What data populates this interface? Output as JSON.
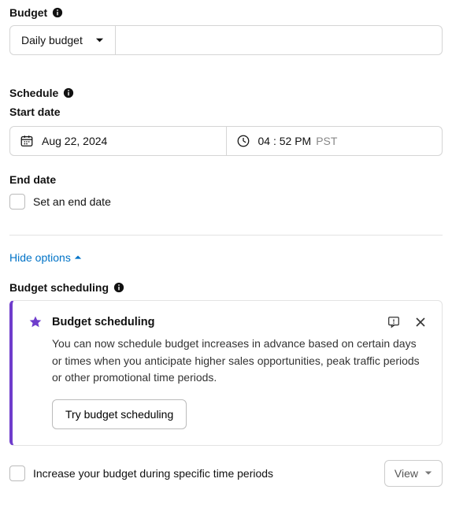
{
  "budget": {
    "label": "Budget",
    "type_selected": "Daily budget",
    "amount": ""
  },
  "schedule": {
    "label": "Schedule",
    "start": {
      "label": "Start date",
      "date": "Aug 22, 2024",
      "time": "04 : 52 PM",
      "tz": "PST"
    },
    "end": {
      "label": "End date",
      "checkbox_label": "Set an end date"
    }
  },
  "options_toggle": "Hide options",
  "budget_scheduling": {
    "section_label": "Budget scheduling",
    "callout": {
      "title": "Budget scheduling",
      "body": "You can now schedule budget increases in advance based on certain days or times when you anticipate higher sales opportunities, peak traffic periods or other promotional time periods.",
      "cta": "Try budget scheduling"
    },
    "increase_checkbox_label": "Increase your budget during specific time periods",
    "view_label": "View"
  }
}
